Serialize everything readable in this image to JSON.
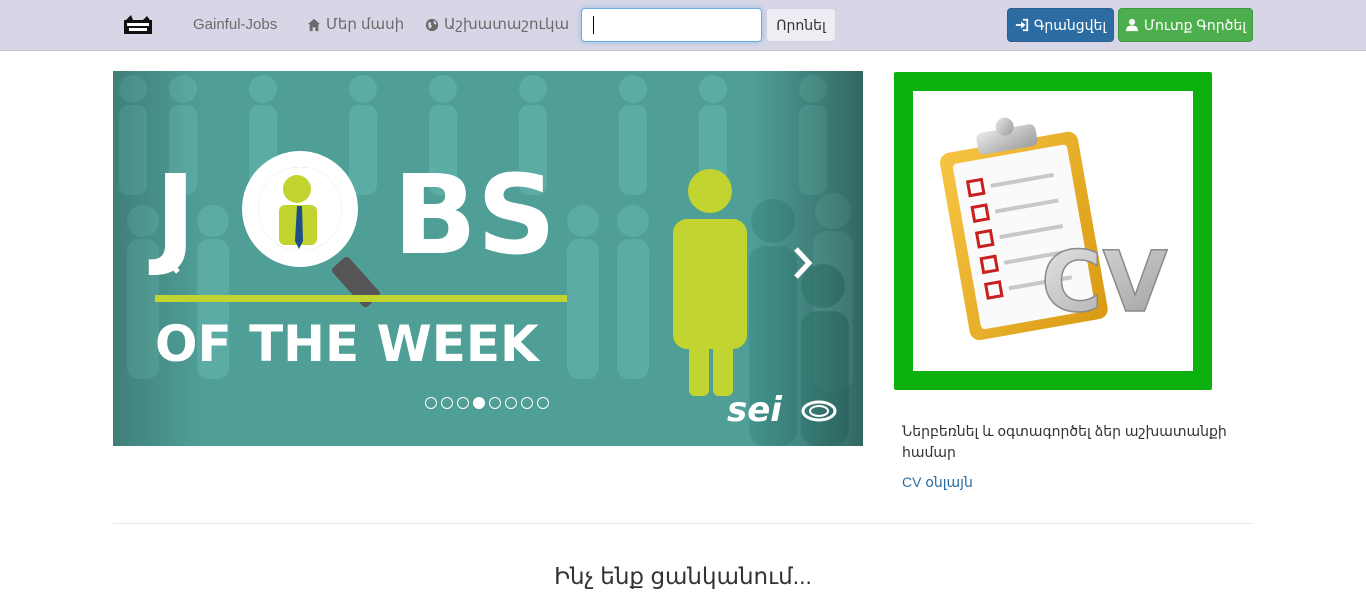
{
  "nav": {
    "brand": "Gainful-Jobs",
    "about": "Մեր մասի",
    "worldwide": "Աշխատաշուկա",
    "search_placeholder": "",
    "search_button": "Որոնել",
    "login": "Գրանցվել",
    "register": "Մուտք Գործել"
  },
  "carousel": {
    "banner_title_1": "J",
    "banner_title_2": "BS",
    "banner_subtitle": "OF THE WEEK",
    "banner_brand": "sei",
    "indicator_count": 8,
    "active_index": 3,
    "prev": "‹",
    "next": "›"
  },
  "cv": {
    "description": "Ներբեռնել և օգտագործել ձեր աշխատանքի համար",
    "link": "CV օնլայն",
    "image_text": "CV",
    "frame_color": "#0db10d"
  },
  "section": {
    "heading": "Ինչ ենք ցանկանում..."
  },
  "colors": {
    "navbar": "#d8d6e6",
    "login_button": "#2d6ca2",
    "register_button": "#4cae4c",
    "link": "#2a6ba4"
  }
}
